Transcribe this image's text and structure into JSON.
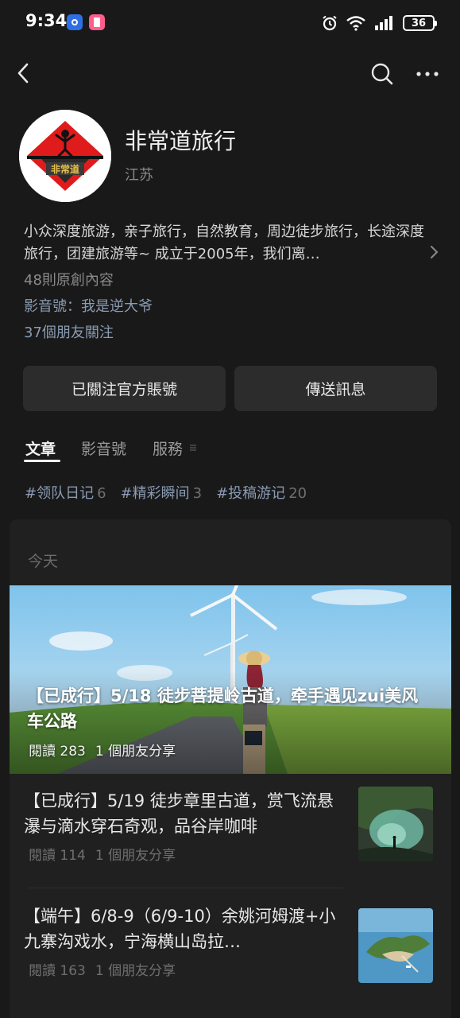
{
  "status_bar": {
    "time": "9:34",
    "battery": "36",
    "icons": [
      "app-icon-blue",
      "app-icon-pink",
      "alarm-icon",
      "wifi-icon",
      "signal-icon",
      "battery-icon"
    ]
  },
  "nav": {
    "icons": [
      "back-icon",
      "search-icon",
      "more-icon"
    ]
  },
  "profile": {
    "name": "非常道旅行",
    "region": "江苏",
    "bio": "小众深度旅游，亲子旅行，自然教育，周边徒步旅行，长途深度旅行，团建旅游等~  成立于2005年，我们离…",
    "original_count": "48則原創內容",
    "video_account": "影音號：我是逆大爷",
    "friends_following": "37個朋友關注"
  },
  "buttons": {
    "follow": "已關注官方賬號",
    "message": "傳送訊息"
  },
  "tabs": {
    "articles": "文章",
    "videos": "影音號",
    "services": "服務"
  },
  "tags": [
    {
      "label": "#领队日记",
      "count": "6"
    },
    {
      "label": "#精彩瞬间",
      "count": "3"
    },
    {
      "label": "#投稿游记",
      "count": "20"
    }
  ],
  "feed": {
    "date_label": "今天",
    "hero": {
      "title": "【已成行】5/18 徒步菩提岭古道，牵手遇见zui美风车公路",
      "reads": "閱讀 283",
      "shares": "1 個朋友分享"
    },
    "items": [
      {
        "title": "【已成行】5/19 徒步章里古道，赏飞流悬瀑与滴水穿石奇观，品谷岸咖啡",
        "reads": "閱讀 114",
        "shares": "1 個朋友分享"
      },
      {
        "title": "【端午】6/8-9（6/9-10）余姚河姆渡+小九寨沟戏水，宁海横山岛拉…",
        "reads": "閱讀 163",
        "shares": "1 個朋友分享"
      }
    ]
  },
  "colors": {
    "background": "#191919",
    "link": "#8a9bb3",
    "button": "#2c2c2c",
    "feed_card": "#202020"
  }
}
